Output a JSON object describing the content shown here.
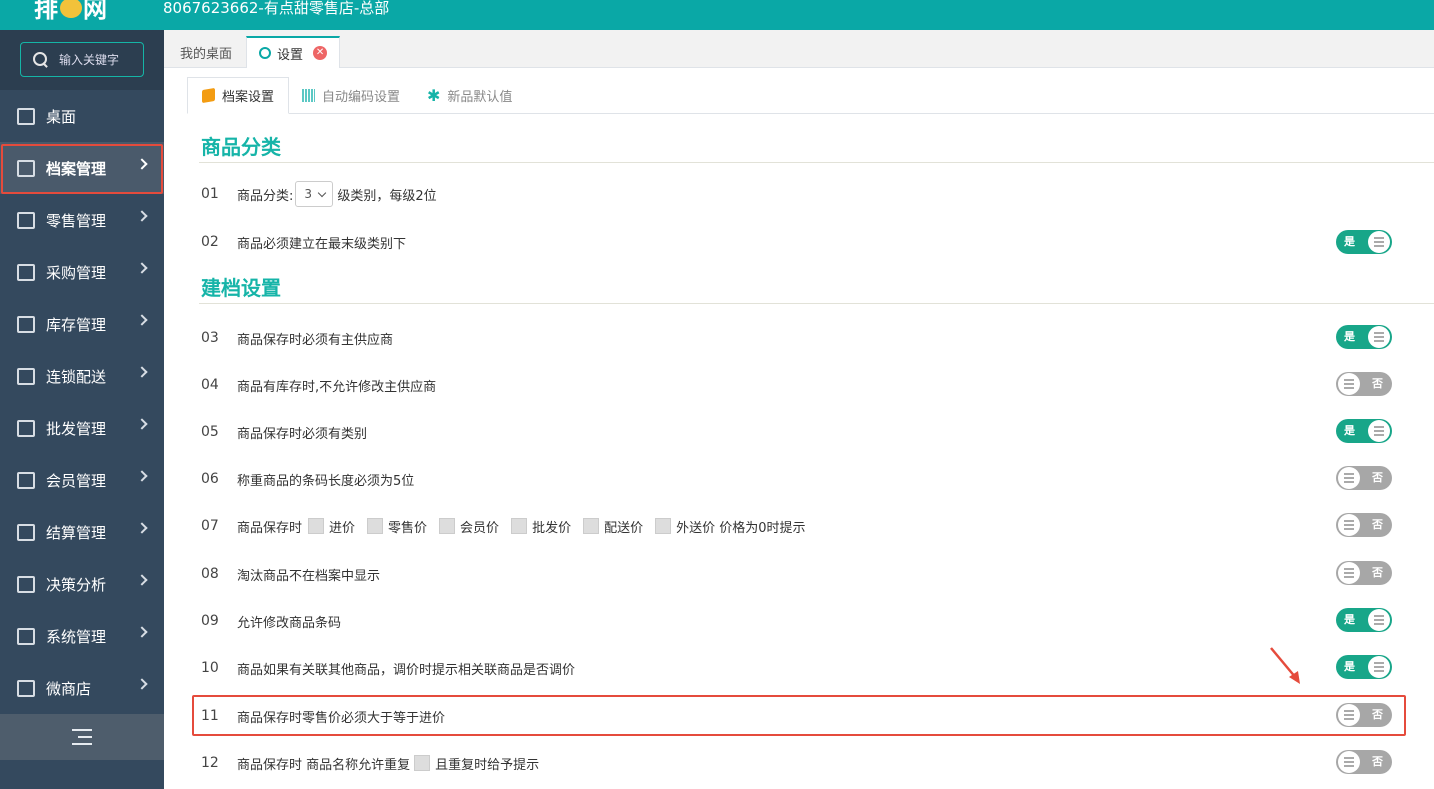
{
  "header": {
    "logo_text": "排",
    "logo_text_2": "网",
    "store_title": "8067623662-有点甜零售店-总部"
  },
  "sidebar": {
    "search_placeholder": "输入关键字",
    "items": [
      {
        "label": "桌面",
        "icon": "monitor-icon",
        "has_arrow": false
      },
      {
        "label": "档案管理",
        "icon": "archive-icon",
        "has_arrow": true,
        "active": true
      },
      {
        "label": "零售管理",
        "icon": "store-icon",
        "has_arrow": true
      },
      {
        "label": "采购管理",
        "icon": "purchase-icon",
        "has_arrow": true
      },
      {
        "label": "库存管理",
        "icon": "inventory-icon",
        "has_arrow": true
      },
      {
        "label": "连锁配送",
        "icon": "truck-icon",
        "has_arrow": true
      },
      {
        "label": "批发管理",
        "icon": "wholesale-icon",
        "has_arrow": true
      },
      {
        "label": "会员管理",
        "icon": "member-icon",
        "has_arrow": true
      },
      {
        "label": "结算管理",
        "icon": "settlement-icon",
        "has_arrow": true
      },
      {
        "label": "决策分析",
        "icon": "chart-icon",
        "has_arrow": true
      },
      {
        "label": "系统管理",
        "icon": "gear-icon",
        "has_arrow": true
      },
      {
        "label": "微商店",
        "icon": "bag-icon",
        "has_arrow": true
      }
    ]
  },
  "tabs": {
    "home": "我的桌面",
    "settings": "设置"
  },
  "subtabs": {
    "archive": "档案设置",
    "autocode": "自动编码设置",
    "defaults": "新品默认值"
  },
  "sections": {
    "category": "商品分类",
    "archive": "建档设置"
  },
  "rows": {
    "r01": {
      "num": "01",
      "prefix": "商品分类:",
      "select_value": "3",
      "suffix": "级类别，每级2位"
    },
    "r02": {
      "num": "02",
      "text": "商品必须建立在最末级类别下",
      "state": "是"
    },
    "r03": {
      "num": "03",
      "text": "商品保存时必须有主供应商",
      "state": "是"
    },
    "r04": {
      "num": "04",
      "text": "商品有库存时,不允许修改主供应商",
      "state": "否"
    },
    "r05": {
      "num": "05",
      "text": "商品保存时必须有类别",
      "state": "是"
    },
    "r06": {
      "num": "06",
      "text": "称重商品的条码长度必须为5位",
      "state": "否"
    },
    "r07": {
      "num": "07",
      "prefix": "商品保存时",
      "opt1": "进价",
      "opt2": "零售价",
      "opt3": "会员价",
      "opt4": "批发价",
      "opt5": "配送价",
      "opt6": "外送价 价格为0时提示",
      "state": "否"
    },
    "r08": {
      "num": "08",
      "text": "淘汰商品不在档案中显示",
      "state": "否"
    },
    "r09": {
      "num": "09",
      "text": "允许修改商品条码",
      "state": "是"
    },
    "r10": {
      "num": "10",
      "text": "商品如果有关联其他商品，调价时提示相关联商品是否调价",
      "state": "是"
    },
    "r11": {
      "num": "11",
      "text": "商品保存时零售价必须大于等于进价",
      "state": "否"
    },
    "r12": {
      "num": "12",
      "prefix": "商品保存时 商品名称允许重复",
      "suffix": "且重复时给予提示",
      "state": "否"
    }
  },
  "colors": {
    "teal": "#0aa8a6",
    "sidebar_bg": "#34495e",
    "toggle_on": "#18a689",
    "toggle_off": "#a7a7a7",
    "highlight_red": "#e54b3c"
  }
}
